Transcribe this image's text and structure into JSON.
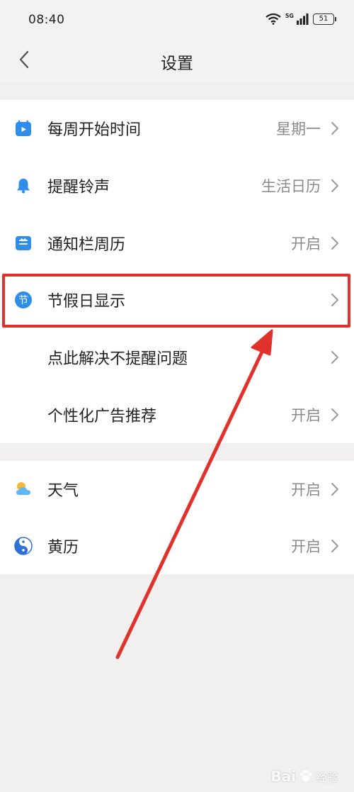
{
  "status_bar": {
    "time": "08:40",
    "network": "5G",
    "battery": "51"
  },
  "header": {
    "title": "设置"
  },
  "group1": [
    {
      "label": "每周开始时间",
      "value": "星期一",
      "icon": "calendar-icon"
    },
    {
      "label": "提醒铃声",
      "value": "生活日历",
      "icon": "bell-icon"
    },
    {
      "label": "通知栏周历",
      "value": "开启",
      "icon": "notification-bar-icon"
    },
    {
      "label": "节假日显示",
      "value": "",
      "icon": "holiday-icon",
      "icon_text": "节"
    },
    {
      "label": "点此解决不提醒问题",
      "value": "",
      "icon": ""
    },
    {
      "label": "个性化广告推荐",
      "value": "开启",
      "icon": ""
    }
  ],
  "group2": [
    {
      "label": "天气",
      "value": "开启",
      "icon": "weather-icon"
    },
    {
      "label": "黄历",
      "value": "开启",
      "icon": "yin-yang-icon"
    }
  ],
  "watermark": {
    "brand": "Bai",
    "suffix": "经验"
  },
  "colors": {
    "accent_blue": "#2f8fe8",
    "annotation_red": "#e0322b",
    "background": "#f1f0ee",
    "value_gray": "#8a8a8a"
  }
}
